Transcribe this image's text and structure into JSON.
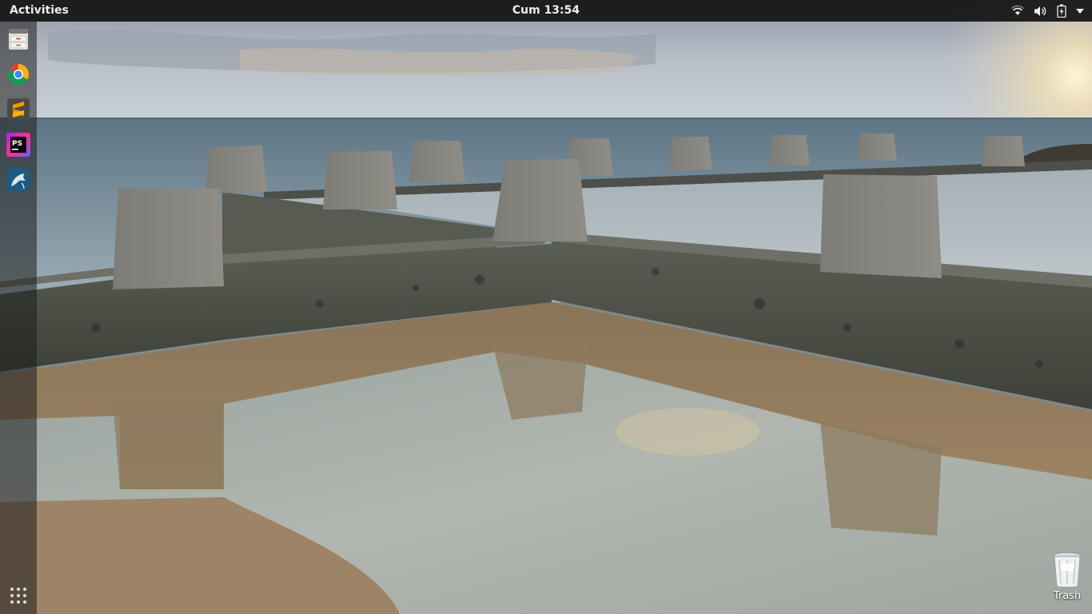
{
  "topbar": {
    "activities_label": "Activities",
    "clock": "Cum 13:54",
    "tray_icons": [
      "wifi-icon",
      "volume-icon",
      "battery-icon",
      "system-menu-arrow-icon"
    ]
  },
  "dock": {
    "items": [
      {
        "name": "files",
        "icon": "file-cabinet-icon"
      },
      {
        "name": "google-chrome",
        "icon": "chrome-icon"
      },
      {
        "name": "sublime-text",
        "icon": "sublime-text-icon"
      },
      {
        "name": "phpstorm",
        "icon": "phpstorm-icon",
        "badge_text": "PS"
      },
      {
        "name": "mysql-workbench",
        "icon": "dolphin-icon"
      }
    ],
    "show_applications_icon": "grid-icon"
  },
  "desktop": {
    "trash_label": "Trash"
  },
  "colors": {
    "topbar_bg": "#121214",
    "topbar_text": "#eeeeec",
    "dock_bg": "#1e1e1e",
    "accent": "#e95420"
  }
}
